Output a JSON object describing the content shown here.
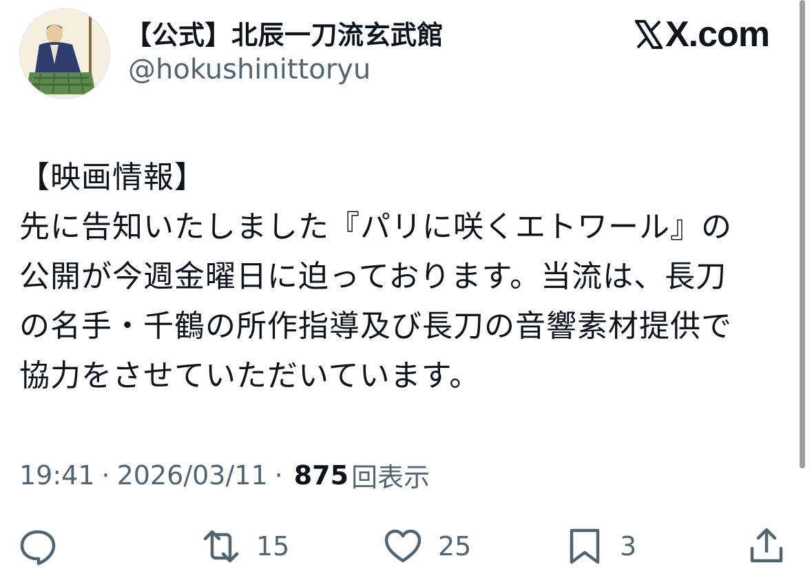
{
  "header": {
    "display_name": "【公式】北辰一刀流玄武館",
    "handle": "@hokushinittoryu",
    "brand": "X.com",
    "avatar_icon": "samurai-portrait-avatar"
  },
  "tweet": {
    "lines": [
      "【映画情報】",
      "先に告知いたしました『パリに咲くエトワール』の",
      "公開が今週金曜日に迫っております。当流は、長刀",
      "の名手・千鶴の所作指導及び長刀の音響素材提供で",
      "協力をさせていただいています。"
    ]
  },
  "meta": {
    "time": "19:41",
    "separator": "·",
    "date": "2026/03/11",
    "views_count": "875",
    "views_label": "回表示"
  },
  "actions": {
    "reply_icon": "reply-icon",
    "retweet_icon": "retweet-icon",
    "retweet_count": "15",
    "like_icon": "heart-icon",
    "like_count": "25",
    "bookmark_icon": "bookmark-icon",
    "bookmark_count": "3",
    "share_icon": "share-icon"
  },
  "colors": {
    "text": "#0f1419",
    "secondary": "#536471",
    "background": "#ffffff"
  }
}
